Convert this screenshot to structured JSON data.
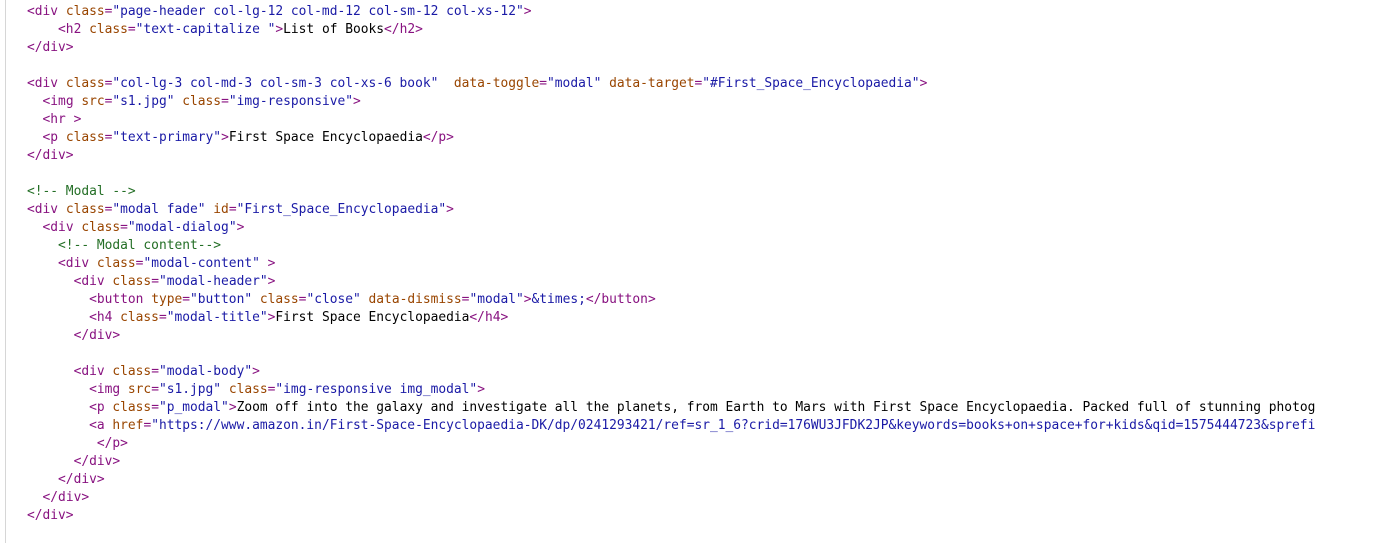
{
  "colors": {
    "tag": "#881280",
    "attribute": "#994500",
    "value": "#1a1aa6",
    "text": "#000000",
    "comment": "#236e25",
    "background": "#ffffff"
  },
  "lines": [
    {
      "indent": "",
      "tokens": [
        {
          "t": "tag",
          "v": "<div "
        },
        {
          "t": "attr",
          "v": "class"
        },
        {
          "t": "tag",
          "v": "="
        },
        {
          "t": "val",
          "v": "\"page-header col-lg-12 col-md-12 col-sm-12 col-xs-12\""
        },
        {
          "t": "tag",
          "v": ">"
        }
      ]
    },
    {
      "indent": "    ",
      "tokens": [
        {
          "t": "tag",
          "v": "<h2 "
        },
        {
          "t": "attr",
          "v": "class"
        },
        {
          "t": "tag",
          "v": "="
        },
        {
          "t": "val",
          "v": "\"text-capitalize \""
        },
        {
          "t": "tag",
          "v": ">"
        },
        {
          "t": "text",
          "v": "List of Books"
        },
        {
          "t": "tag",
          "v": "</h2>"
        }
      ]
    },
    {
      "indent": "",
      "tokens": [
        {
          "t": "tag",
          "v": "</div>"
        }
      ]
    },
    {
      "indent": "",
      "tokens": []
    },
    {
      "indent": "",
      "tokens": [
        {
          "t": "tag",
          "v": "<div "
        },
        {
          "t": "attr",
          "v": "class"
        },
        {
          "t": "tag",
          "v": "="
        },
        {
          "t": "val",
          "v": "\"col-lg-3 col-md-3 col-sm-3 col-xs-6 book\""
        },
        {
          "t": "tag",
          "v": "  "
        },
        {
          "t": "attr",
          "v": "data-toggle"
        },
        {
          "t": "tag",
          "v": "="
        },
        {
          "t": "val",
          "v": "\"modal\""
        },
        {
          "t": "tag",
          "v": " "
        },
        {
          "t": "attr",
          "v": "data-target"
        },
        {
          "t": "tag",
          "v": "="
        },
        {
          "t": "val",
          "v": "\"#First_Space_Encyclopaedia\""
        },
        {
          "t": "tag",
          "v": ">"
        }
      ]
    },
    {
      "indent": "  ",
      "tokens": [
        {
          "t": "tag",
          "v": "<img "
        },
        {
          "t": "attr",
          "v": "src"
        },
        {
          "t": "tag",
          "v": "="
        },
        {
          "t": "val",
          "v": "\"s1.jpg\""
        },
        {
          "t": "tag",
          "v": " "
        },
        {
          "t": "attr",
          "v": "class"
        },
        {
          "t": "tag",
          "v": "="
        },
        {
          "t": "val",
          "v": "\"img-responsive\""
        },
        {
          "t": "tag",
          "v": ">"
        }
      ]
    },
    {
      "indent": "  ",
      "tokens": [
        {
          "t": "tag",
          "v": "<hr >"
        }
      ]
    },
    {
      "indent": "  ",
      "tokens": [
        {
          "t": "tag",
          "v": "<p "
        },
        {
          "t": "attr",
          "v": "class"
        },
        {
          "t": "tag",
          "v": "="
        },
        {
          "t": "val",
          "v": "\"text-primary\""
        },
        {
          "t": "tag",
          "v": ">"
        },
        {
          "t": "text",
          "v": "First Space Encyclopaedia"
        },
        {
          "t": "tag",
          "v": "</p>"
        }
      ]
    },
    {
      "indent": "",
      "tokens": [
        {
          "t": "tag",
          "v": "</div>"
        }
      ]
    },
    {
      "indent": "",
      "tokens": []
    },
    {
      "indent": "",
      "tokens": [
        {
          "t": "comment",
          "v": "<!-- Modal -->"
        }
      ]
    },
    {
      "indent": "",
      "tokens": [
        {
          "t": "tag",
          "v": "<div "
        },
        {
          "t": "attr",
          "v": "class"
        },
        {
          "t": "tag",
          "v": "="
        },
        {
          "t": "val",
          "v": "\"modal fade\""
        },
        {
          "t": "tag",
          "v": " "
        },
        {
          "t": "attr",
          "v": "id"
        },
        {
          "t": "tag",
          "v": "="
        },
        {
          "t": "val",
          "v": "\"First_Space_Encyclopaedia\""
        },
        {
          "t": "tag",
          "v": ">"
        }
      ]
    },
    {
      "indent": "  ",
      "tokens": [
        {
          "t": "tag",
          "v": "<div "
        },
        {
          "t": "attr",
          "v": "class"
        },
        {
          "t": "tag",
          "v": "="
        },
        {
          "t": "val",
          "v": "\"modal-dialog\""
        },
        {
          "t": "tag",
          "v": ">"
        }
      ]
    },
    {
      "indent": "    ",
      "tokens": [
        {
          "t": "comment",
          "v": "<!-- Modal content-->"
        }
      ]
    },
    {
      "indent": "    ",
      "tokens": [
        {
          "t": "tag",
          "v": "<div "
        },
        {
          "t": "attr",
          "v": "class"
        },
        {
          "t": "tag",
          "v": "="
        },
        {
          "t": "val",
          "v": "\"modal-content\""
        },
        {
          "t": "tag",
          "v": " >"
        }
      ]
    },
    {
      "indent": "      ",
      "tokens": [
        {
          "t": "tag",
          "v": "<div "
        },
        {
          "t": "attr",
          "v": "class"
        },
        {
          "t": "tag",
          "v": "="
        },
        {
          "t": "val",
          "v": "\"modal-header\""
        },
        {
          "t": "tag",
          "v": ">"
        }
      ]
    },
    {
      "indent": "        ",
      "tokens": [
        {
          "t": "tag",
          "v": "<button "
        },
        {
          "t": "attr",
          "v": "type"
        },
        {
          "t": "tag",
          "v": "="
        },
        {
          "t": "val",
          "v": "\"button\""
        },
        {
          "t": "tag",
          "v": " "
        },
        {
          "t": "attr",
          "v": "class"
        },
        {
          "t": "tag",
          "v": "="
        },
        {
          "t": "val",
          "v": "\"close\""
        },
        {
          "t": "tag",
          "v": " "
        },
        {
          "t": "attr",
          "v": "data-dismiss"
        },
        {
          "t": "tag",
          "v": "="
        },
        {
          "t": "val",
          "v": "\"modal\""
        },
        {
          "t": "tag",
          "v": ">"
        },
        {
          "t": "entity",
          "v": "&times;"
        },
        {
          "t": "tag",
          "v": "</button>"
        }
      ]
    },
    {
      "indent": "        ",
      "tokens": [
        {
          "t": "tag",
          "v": "<h4 "
        },
        {
          "t": "attr",
          "v": "class"
        },
        {
          "t": "tag",
          "v": "="
        },
        {
          "t": "val",
          "v": "\"modal-title\""
        },
        {
          "t": "tag",
          "v": ">"
        },
        {
          "t": "text",
          "v": "First Space Encyclopaedia"
        },
        {
          "t": "tag",
          "v": "</h4>"
        }
      ]
    },
    {
      "indent": "      ",
      "tokens": [
        {
          "t": "tag",
          "v": "</div>"
        }
      ]
    },
    {
      "indent": "",
      "tokens": []
    },
    {
      "indent": "      ",
      "tokens": [
        {
          "t": "tag",
          "v": "<div "
        },
        {
          "t": "attr",
          "v": "class"
        },
        {
          "t": "tag",
          "v": "="
        },
        {
          "t": "val",
          "v": "\"modal-body\""
        },
        {
          "t": "tag",
          "v": ">"
        }
      ]
    },
    {
      "indent": "        ",
      "tokens": [
        {
          "t": "tag",
          "v": "<img "
        },
        {
          "t": "attr",
          "v": "src"
        },
        {
          "t": "tag",
          "v": "="
        },
        {
          "t": "val",
          "v": "\"s1.jpg\""
        },
        {
          "t": "tag",
          "v": " "
        },
        {
          "t": "attr",
          "v": "class"
        },
        {
          "t": "tag",
          "v": "="
        },
        {
          "t": "val",
          "v": "\"img-responsive img_modal\""
        },
        {
          "t": "tag",
          "v": ">"
        }
      ]
    },
    {
      "indent": "        ",
      "tokens": [
        {
          "t": "tag",
          "v": "<p "
        },
        {
          "t": "attr",
          "v": "class"
        },
        {
          "t": "tag",
          "v": "="
        },
        {
          "t": "val",
          "v": "\"p_modal\""
        },
        {
          "t": "tag",
          "v": ">"
        },
        {
          "t": "text",
          "v": "Zoom off into the galaxy and investigate all the planets, from Earth to Mars with First Space Encyclopaedia. Packed full of stunning photog"
        }
      ]
    },
    {
      "indent": "        ",
      "tokens": [
        {
          "t": "tag",
          "v": "<a "
        },
        {
          "t": "attr",
          "v": "href"
        },
        {
          "t": "tag",
          "v": "="
        },
        {
          "t": "val",
          "v": "\"https://www.amazon.in/First-Space-Encyclopaedia-DK/dp/0241293421/ref=sr_1_6?crid=176WU3JFDK2JP&keywords=books+on+space+for+kids&qid=1575444723&sprefi"
        }
      ]
    },
    {
      "indent": "         ",
      "tokens": [
        {
          "t": "tag",
          "v": "</p>"
        }
      ]
    },
    {
      "indent": "      ",
      "tokens": [
        {
          "t": "tag",
          "v": "</div>"
        }
      ]
    },
    {
      "indent": "    ",
      "tokens": [
        {
          "t": "tag",
          "v": "</div>"
        }
      ]
    },
    {
      "indent": "  ",
      "tokens": [
        {
          "t": "tag",
          "v": "</div>"
        }
      ]
    },
    {
      "indent": "",
      "tokens": [
        {
          "t": "tag",
          "v": "</div>"
        }
      ]
    }
  ]
}
